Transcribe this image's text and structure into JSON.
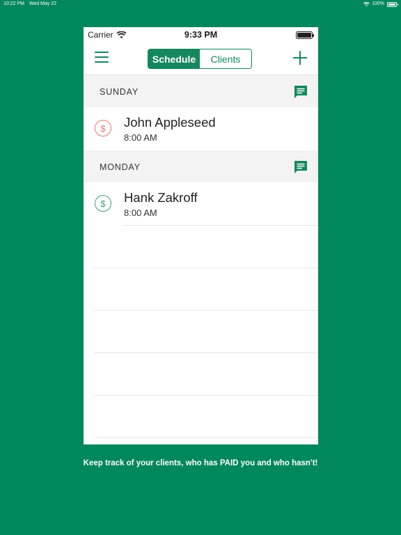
{
  "device_status": {
    "time": "10:22 PM",
    "date": "Wed May 22",
    "battery": "100%"
  },
  "phone_status": {
    "carrier": "Carrier",
    "time": "9:33 PM"
  },
  "nav": {
    "tabs": [
      {
        "label": "Schedule",
        "active": true
      },
      {
        "label": "Clients",
        "active": false
      }
    ],
    "menu_icon": "hamburger-menu-icon",
    "add_icon": "plus-icon"
  },
  "schedule": [
    {
      "day": "SUNDAY",
      "appointments": [
        {
          "client": "John Appleseed",
          "time": "8:00 AM",
          "paid": false
        }
      ]
    },
    {
      "day": "MONDAY",
      "appointments": [
        {
          "client": "Hank Zakroff",
          "time": "8:00 AM",
          "paid": true
        }
      ]
    }
  ],
  "colors": {
    "background": "#01875c",
    "accent": "#14875e",
    "unpaid": "#e8776b",
    "paid": "#3f9c7a"
  },
  "caption": "Keep track of your clients, who has PAID you and who hasn't!"
}
